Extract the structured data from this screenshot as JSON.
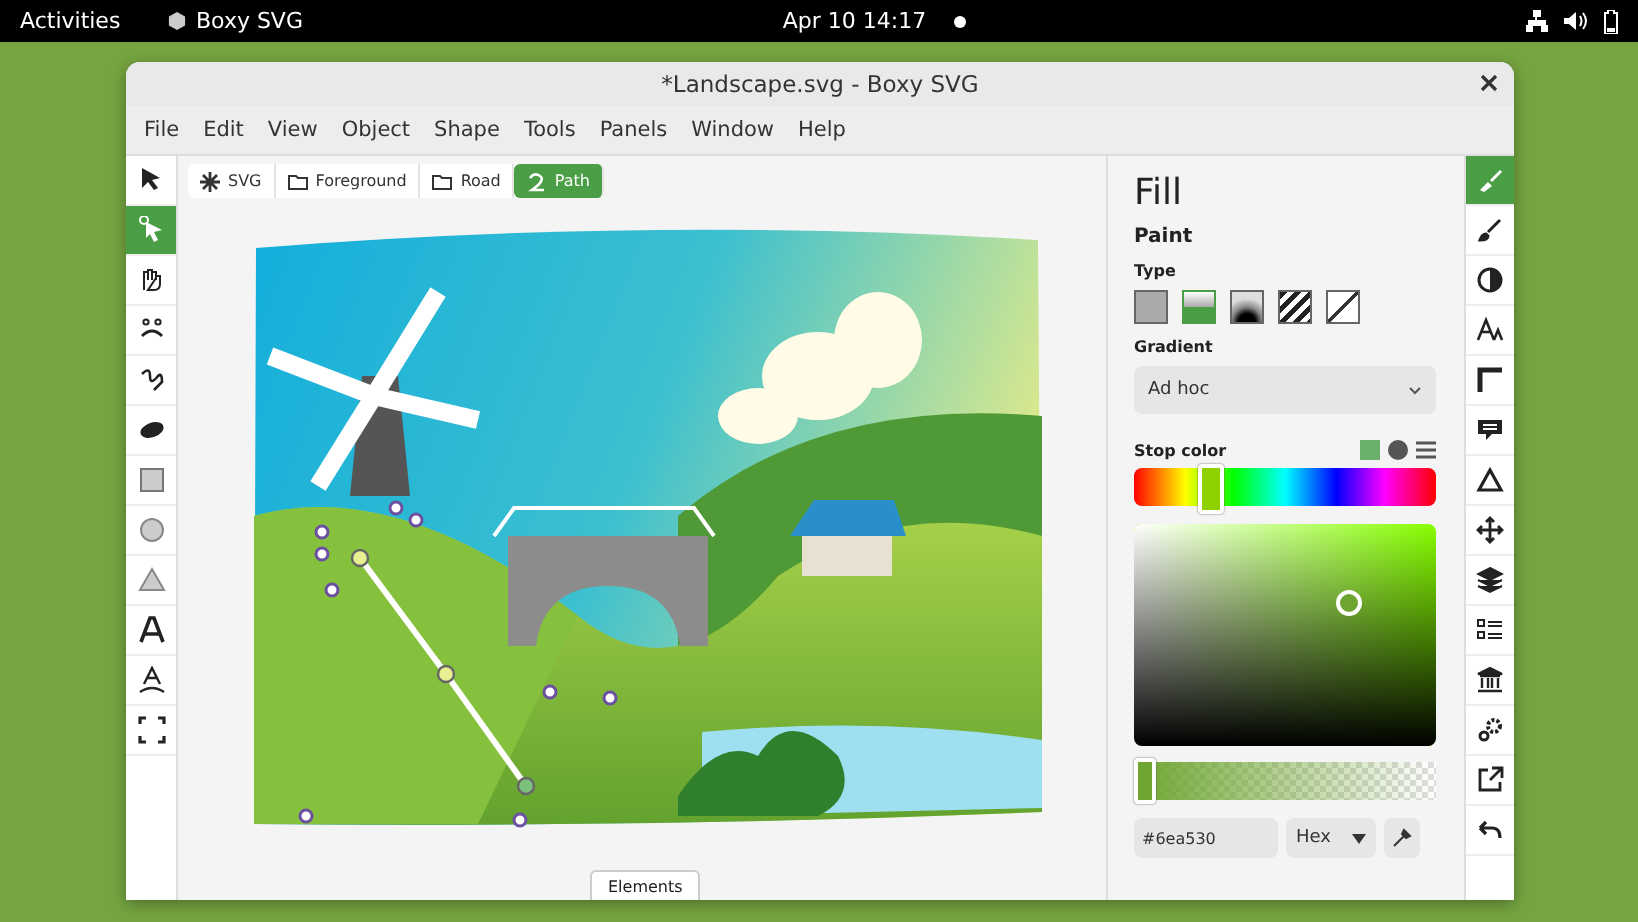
{
  "top_bar": {
    "activities": "Activities",
    "app_name": "Boxy SVG",
    "clock": "Apr 10  14:17"
  },
  "window": {
    "title": "*Landscape.svg - Boxy SVG"
  },
  "menu": [
    "File",
    "Edit",
    "View",
    "Object",
    "Shape",
    "Tools",
    "Panels",
    "Window",
    "Help"
  ],
  "tools": [
    {
      "selected": false
    },
    {
      "selected": true
    },
    {
      "selected": false
    },
    {
      "selected": false
    },
    {
      "selected": false
    },
    {
      "selected": false
    },
    {
      "selected": false
    },
    {
      "selected": false
    },
    {
      "selected": false
    },
    {
      "selected": false
    },
    {
      "selected": false
    },
    {
      "selected": false
    }
  ],
  "breadcrumbs": [
    {
      "kind": "svg",
      "label": "SVG",
      "selected": false
    },
    {
      "kind": "group",
      "label": "Foreground",
      "selected": false
    },
    {
      "kind": "group",
      "label": "Road",
      "selected": false
    },
    {
      "kind": "path",
      "label": "Path",
      "selected": true
    }
  ],
  "elements_tab": "Elements",
  "fill_panel": {
    "title": "Fill",
    "section": "Paint",
    "type_label": "Type",
    "types": [
      {
        "kind": "flat",
        "selected": false
      },
      {
        "kind": "linear",
        "selected": true
      },
      {
        "kind": "radial",
        "selected": false
      },
      {
        "kind": "pattern",
        "selected": false
      },
      {
        "kind": "none",
        "selected": false
      }
    ],
    "gradient_label": "Gradient",
    "gradient_value": "Ad hoc",
    "stop_color_label": "Stop color",
    "stop_modes": [
      {
        "kind": "square",
        "selected": true
      },
      {
        "kind": "circle",
        "selected": false
      },
      {
        "kind": "list",
        "selected": false
      }
    ],
    "hue_slider": {
      "level": 0.25
    },
    "alpha_slider": {
      "level": 0
    },
    "hex_value": "#6ea530",
    "format": "Hex"
  },
  "panel_tabs": [
    {
      "selected": true
    },
    {
      "selected": false
    },
    {
      "selected": false
    },
    {
      "selected": false
    },
    {
      "selected": false
    },
    {
      "selected": false
    },
    {
      "selected": false
    },
    {
      "selected": false
    },
    {
      "selected": false
    },
    {
      "selected": false
    },
    {
      "selected": false
    },
    {
      "selected": false
    },
    {
      "selected": false
    },
    {
      "selected": false
    }
  ]
}
